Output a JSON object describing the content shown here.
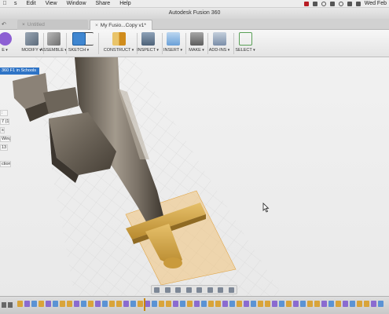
{
  "menubar": {
    "apple": "",
    "items": [
      "s",
      "Edit",
      "View",
      "Window",
      "Share",
      "Help"
    ],
    "clock": "Wed Feb"
  },
  "window": {
    "title": "Autodesk Fusion 360"
  },
  "tabs": [
    {
      "label": "Untitled",
      "active": false
    },
    {
      "label": "My Fusio...Copy v1*",
      "active": true
    }
  ],
  "ribbon": [
    {
      "label": "E",
      "color": "#8d5fd3"
    },
    {
      "label": "MODIFY",
      "color": "#6c7a8a"
    },
    {
      "label": "ASSEMBLE",
      "color": "#8a8a8a"
    },
    {
      "label": "SKETCH",
      "color": "#3f86d0"
    },
    {
      "label": "CONSTRUCT",
      "color": "#d8a02c"
    },
    {
      "label": "INSPECT",
      "color": "#5e7489"
    },
    {
      "label": "INSERT",
      "color": "#6aa0d8"
    },
    {
      "label": "MAKE",
      "color": "#7a7a7a"
    },
    {
      "label": "ADD-INS",
      "color": "#7b8ea8"
    },
    {
      "label": "SELECT",
      "color": "#5aa057"
    }
  ],
  "browser": {
    "header": "360 F1 in Schools",
    "items": [
      ":",
      "7 (1)",
      "s",
      "Wing",
      "13",
      "ction"
    ]
  },
  "timeline": {
    "feature_colors": [
      "#d9a43a",
      "#8a6bd0",
      "#5b93d4",
      "#d9a43a",
      "#8a6bd0",
      "#5b93d4",
      "#d9a43a"
    ]
  }
}
